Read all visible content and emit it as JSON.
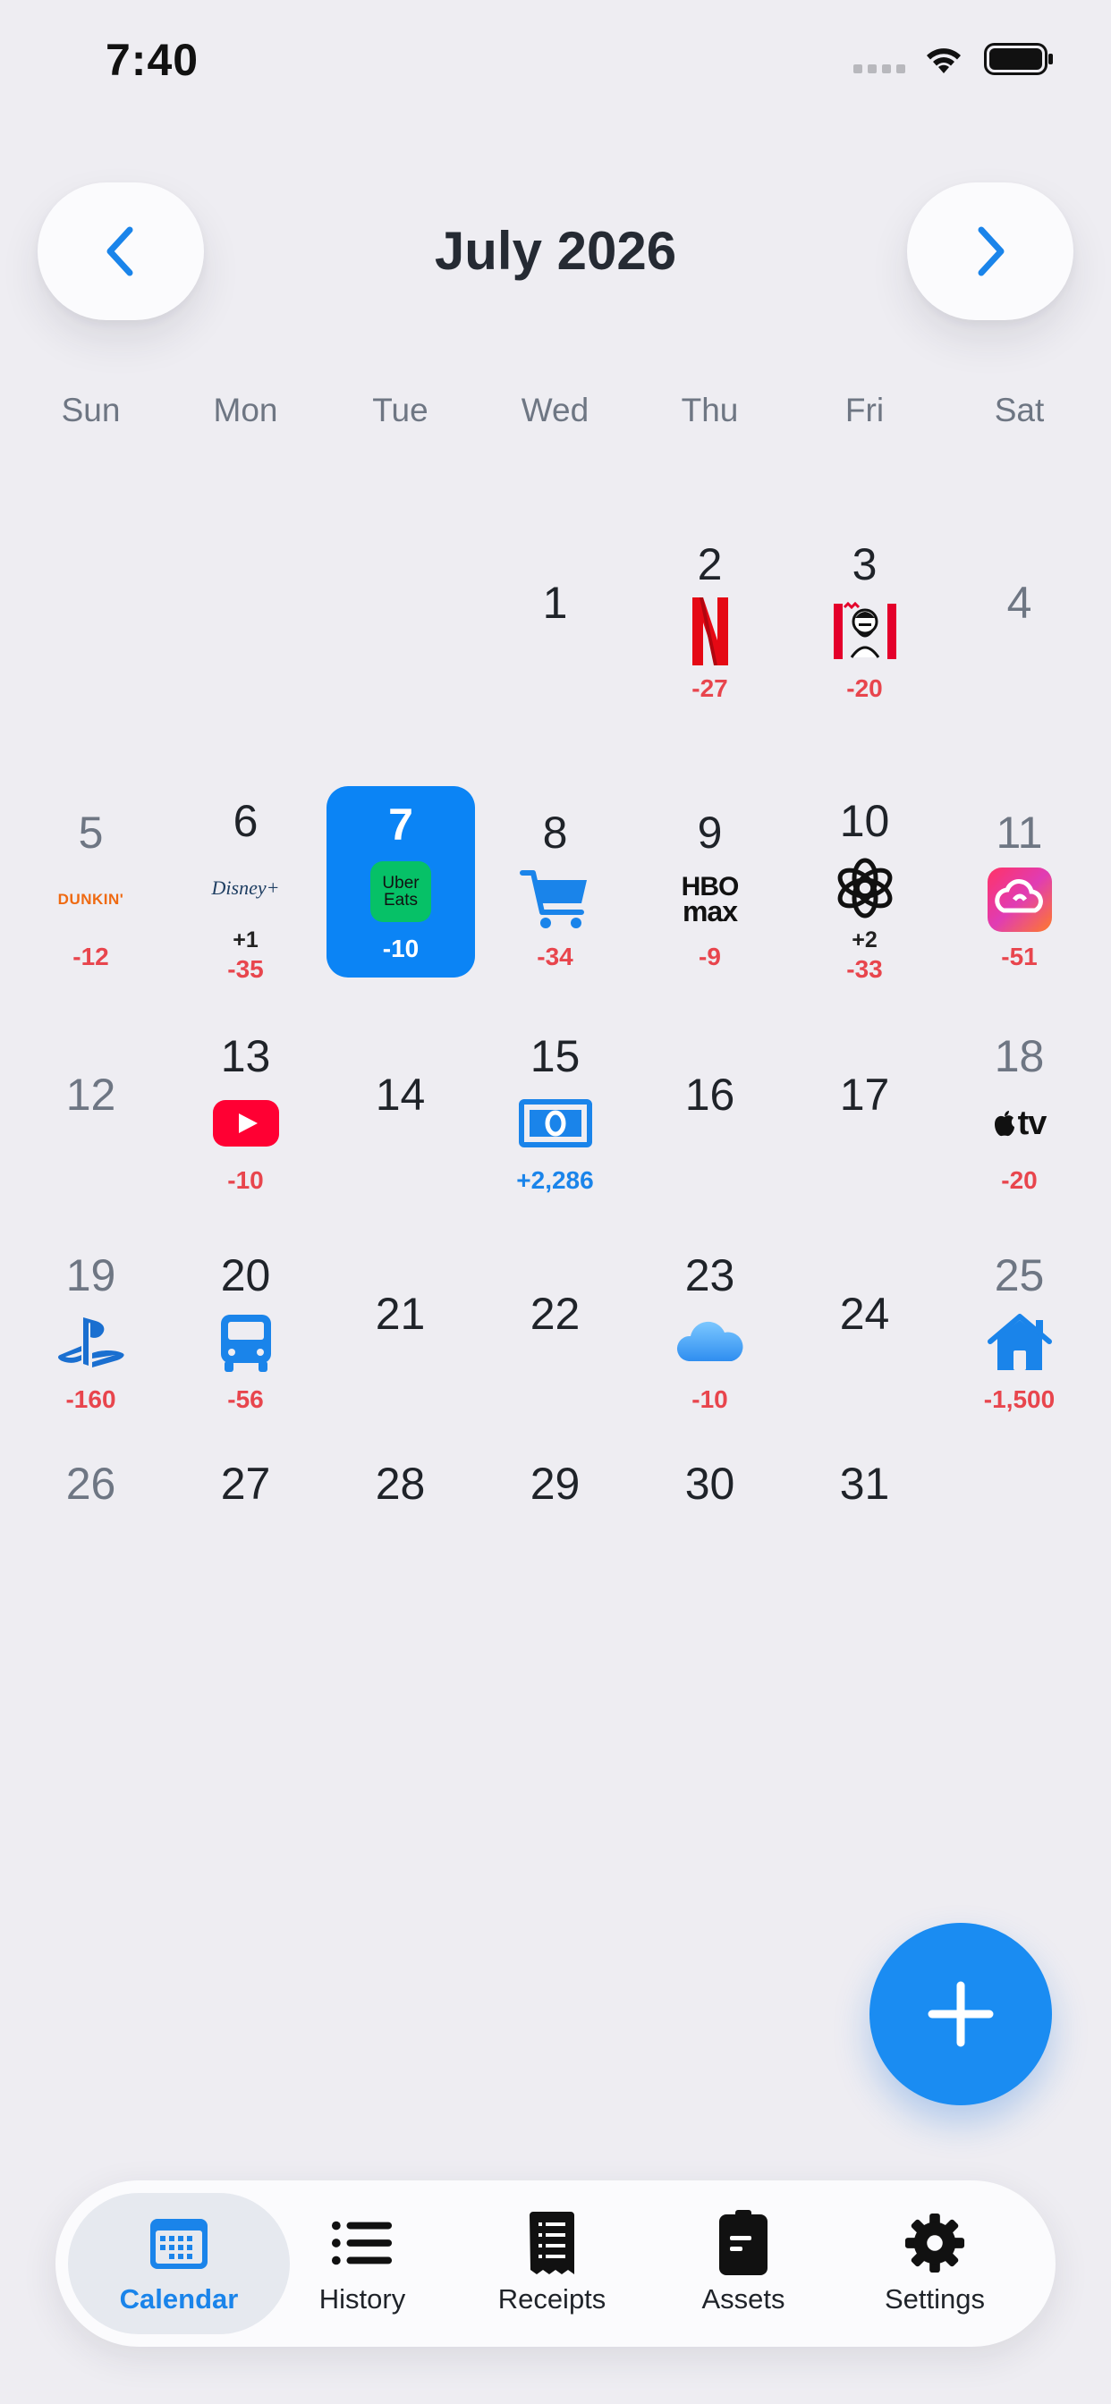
{
  "status_bar": {
    "time": "7:40"
  },
  "header": {
    "month_title": "July 2026"
  },
  "weekdays": [
    "Sun",
    "Mon",
    "Tue",
    "Wed",
    "Thu",
    "Fri",
    "Sat"
  ],
  "calendar": {
    "days": [
      {
        "n": "1"
      },
      {
        "n": "2",
        "icon": "netflix-icon",
        "amount": "-27"
      },
      {
        "n": "3",
        "icon": "kfc-icon",
        "amount": "-20"
      },
      {
        "n": "4"
      },
      {
        "n": "5",
        "icon": "dunkin-icon",
        "icon_text": "DUNKIN'",
        "amount": "-12"
      },
      {
        "n": "6",
        "icon": "disney-plus-icon",
        "icon_text": "Disney+",
        "extra": "+1",
        "amount": "-35"
      },
      {
        "n": "7",
        "icon": "uber-eats-icon",
        "icon_text": "Uber Eats",
        "amount": "-10",
        "selected": true
      },
      {
        "n": "8",
        "icon": "shopping-cart-icon",
        "amount": "-34"
      },
      {
        "n": "9",
        "icon": "hbo-max-icon",
        "icon_text": "HBO max",
        "amount": "-9"
      },
      {
        "n": "10",
        "icon": "openai-icon",
        "extra": "+2",
        "amount": "-33"
      },
      {
        "n": "11",
        "icon": "creative-cloud-icon",
        "amount": "-51"
      },
      {
        "n": "12"
      },
      {
        "n": "13",
        "icon": "youtube-icon",
        "amount": "-10"
      },
      {
        "n": "14"
      },
      {
        "n": "15",
        "icon": "banknote-icon",
        "amount": "+2,286",
        "income": true
      },
      {
        "n": "16"
      },
      {
        "n": "17"
      },
      {
        "n": "18",
        "icon": "apple-tv-icon",
        "icon_text": "tv",
        "amount": "-20"
      },
      {
        "n": "19",
        "icon": "playstation-icon",
        "amount": "-160"
      },
      {
        "n": "20",
        "icon": "bus-icon",
        "amount": "-56"
      },
      {
        "n": "21"
      },
      {
        "n": "22"
      },
      {
        "n": "23",
        "icon": "icloud-icon",
        "amount": "-10"
      },
      {
        "n": "24"
      },
      {
        "n": "25",
        "icon": "house-icon",
        "amount": "-1,500"
      },
      {
        "n": "26"
      },
      {
        "n": "27"
      },
      {
        "n": "28"
      },
      {
        "n": "29"
      },
      {
        "n": "30"
      },
      {
        "n": "31"
      }
    ]
  },
  "tabs": [
    {
      "label": "Calendar",
      "icon": "calendar-icon",
      "active": true
    },
    {
      "label": "History",
      "icon": "list-icon"
    },
    {
      "label": "Receipts",
      "icon": "receipt-icon"
    },
    {
      "label": "Assets",
      "icon": "card-icon"
    },
    {
      "label": "Settings",
      "icon": "gear-icon"
    }
  ],
  "colors": {
    "accent": "#0b84f5",
    "expense": "#e8454d",
    "income": "#1a84ea",
    "background": "#eeedf2"
  }
}
